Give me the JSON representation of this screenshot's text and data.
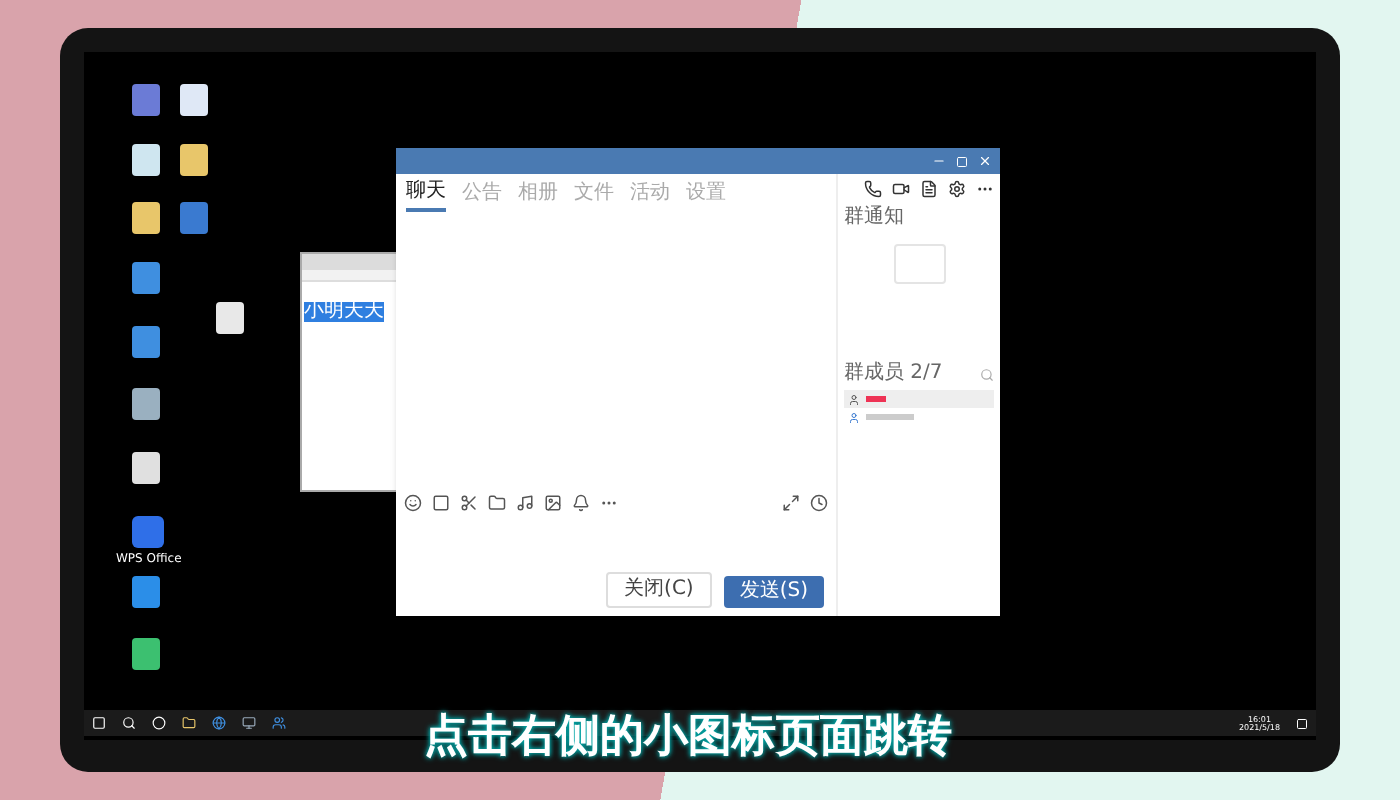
{
  "desktop": {
    "wps_label": "WPS Office"
  },
  "notepad": {
    "text": "小明天天",
    "selected": true
  },
  "chat_window": {
    "tabs": [
      {
        "label": "聊天",
        "selected": true
      },
      {
        "label": "公告",
        "selected": false
      },
      {
        "label": "相册",
        "selected": false
      },
      {
        "label": "文件",
        "selected": false
      },
      {
        "label": "活动",
        "selected": false
      },
      {
        "label": "设置",
        "selected": false
      }
    ],
    "notice_title": "群通知",
    "members_title": "群成员 2/7",
    "buttons": [
      {
        "label": "关闭(C)",
        "kind": "secondary"
      },
      {
        "label": "发送(S)",
        "kind": "primary"
      }
    ]
  },
  "taskbar": {
    "clock": "16:01",
    "date": "2021/5/18"
  },
  "subtitle": "点击右侧的小图标页面跳转"
}
